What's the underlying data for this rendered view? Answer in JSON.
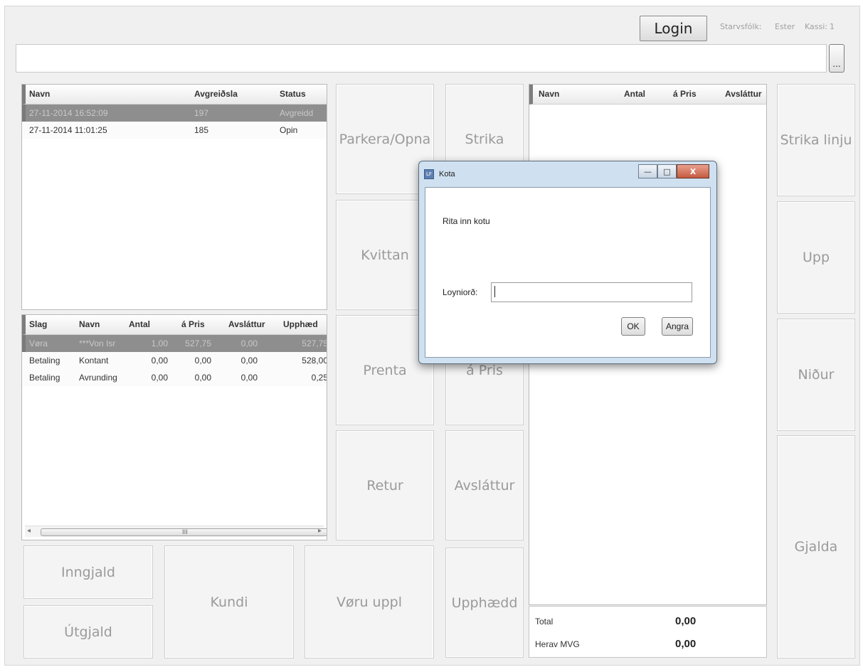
{
  "toolbar": {
    "login_label": "Login",
    "staff_label": "Starvsfólk:",
    "staff_value": "Ester",
    "till_label": "Kassi:",
    "till_value": "1",
    "more_label": "..."
  },
  "search": {
    "value": ""
  },
  "sessions_table": {
    "columns": [
      "Navn",
      "Avgreiðsla",
      "Status"
    ],
    "rows": [
      {
        "name": "27-11-2014 16:52:09",
        "number": "197",
        "status": "Avgreidd",
        "selected": true
      },
      {
        "name": "27-11-2014 11:01:25",
        "number": "185",
        "status": "Opin",
        "selected": false
      }
    ]
  },
  "lines_table": {
    "columns": [
      "Slag",
      "Navn",
      "Antal",
      "á Pris",
      "Avsláttur",
      "Upphæd"
    ],
    "rows": [
      {
        "type": "Vøra",
        "name": "***Von Isr",
        "qty": "1,00",
        "price": "527,75",
        "discount": "0,00",
        "amount": "527,75",
        "selected": true
      },
      {
        "type": "Betaling",
        "name": "Kontant",
        "qty": "0,00",
        "price": "0,00",
        "discount": "0,00",
        "amount": "528,00",
        "selected": false
      },
      {
        "type": "Betaling",
        "name": "Avrunding",
        "qty": "0,00",
        "price": "0,00",
        "discount": "0,00",
        "amount": "0,25",
        "selected": false
      }
    ],
    "scroll_grip": "III"
  },
  "buttons": {
    "parkera": "Parkera/Opna",
    "kvittan": "Kvittan",
    "prenta": "Prenta",
    "retur": "Retur",
    "strika": "Strika",
    "apris": "á Pris",
    "avslattur": "Avsláttur",
    "upphaedd": "Upphædd",
    "inngjald": "Inngjald",
    "utgjald": "Útgjald",
    "kundi": "Kundi",
    "voru_uppl": "Vøru uppl",
    "strika_linju": "Strika linju",
    "upp": "Upp",
    "nidur": "Niður",
    "gjalda": "Gjalda"
  },
  "cart_table": {
    "columns": [
      "Navn",
      "Antal",
      "á Pris",
      "Avsláttur"
    ]
  },
  "totals": {
    "total_label": "Total",
    "total_value": "0,00",
    "vat_label": "Herav MVG",
    "vat_value": "0,00"
  },
  "dialog": {
    "icon_text": "LF",
    "title": "Kota",
    "minimize": "—",
    "maximize": "□",
    "close": "X",
    "prompt": "Rita inn kotu",
    "password_label": "Loyniorð:",
    "password_value": "",
    "ok": "OK",
    "cancel": "Angra"
  }
}
